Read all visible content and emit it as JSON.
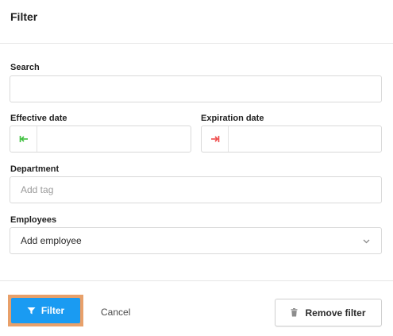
{
  "dialog": {
    "title": "Filter"
  },
  "fields": {
    "search": {
      "label": "Search",
      "value": "",
      "placeholder": ""
    },
    "effective_date": {
      "label": "Effective date",
      "value": "",
      "icon": "arrow-to-left-icon",
      "icon_color": "#3cbf3c"
    },
    "expiration_date": {
      "label": "Expiration date",
      "value": "",
      "icon": "arrow-to-right-icon",
      "icon_color": "#ef4b4b"
    },
    "department": {
      "label": "Department",
      "placeholder": "Add tag"
    },
    "employees": {
      "label": "Employees",
      "selected": "Add employee",
      "icon": "chevron-down-icon"
    }
  },
  "footer": {
    "filter_label": "Filter",
    "filter_icon": "funnel-icon",
    "cancel_label": "Cancel",
    "remove_label": "Remove filter",
    "remove_icon": "trash-icon"
  },
  "colors": {
    "primary": "#1a9bf2",
    "highlight": "#e8a06a"
  }
}
